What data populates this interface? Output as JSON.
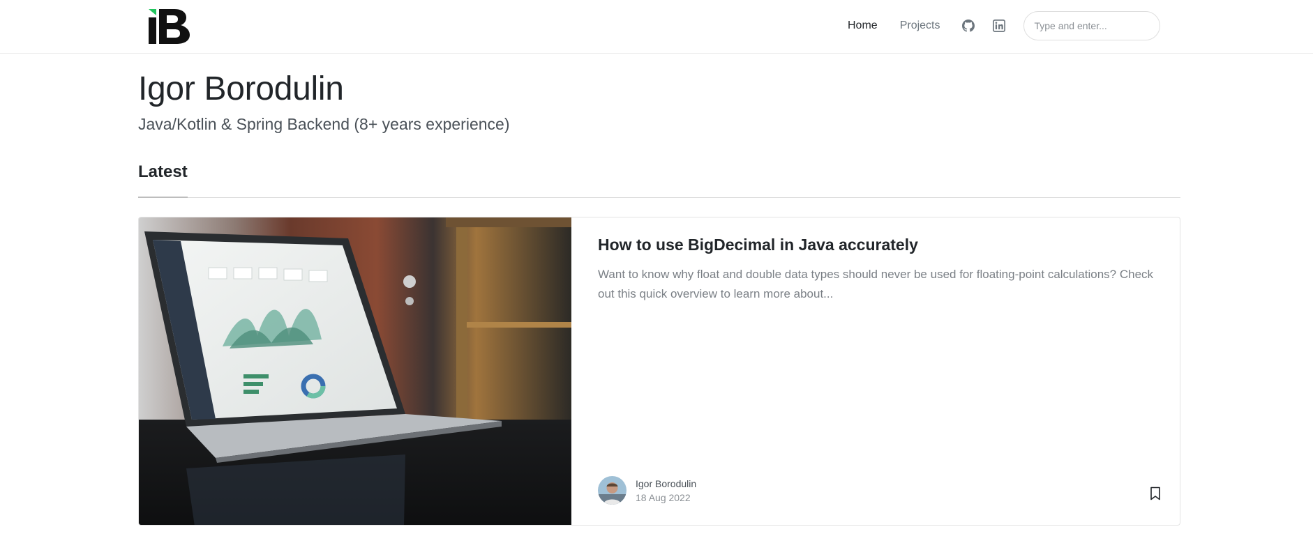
{
  "brand": {
    "logo_text": "iB",
    "accent_color": "#22c55e"
  },
  "nav": {
    "home_label": "Home",
    "projects_label": "Projects",
    "icons": [
      "github-icon",
      "linkedin-icon"
    ],
    "search_placeholder": "Type and enter..."
  },
  "hero": {
    "name": "Igor Borodulin",
    "subtitle": "Java/Kotlin & Spring Backend (8+ years experience)"
  },
  "latest": {
    "heading": "Latest",
    "posts": [
      {
        "title": "How to use BigDecimal in Java accurately",
        "excerpt": "Want to know why float and double data types should never be used for floating-point calculations? Check out this quick overview to learn more about...",
        "author": "Igor Borodulin",
        "date": "18 Aug 2022",
        "image": "laptop-analytics-dashboard-photo"
      }
    ]
  }
}
